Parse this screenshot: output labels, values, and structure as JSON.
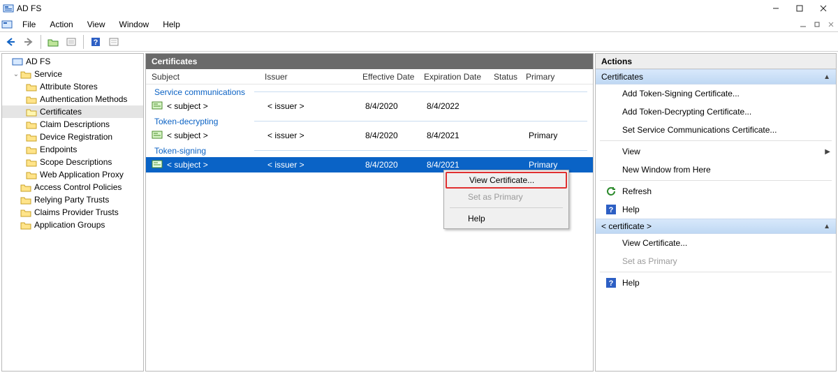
{
  "window": {
    "title": "AD FS"
  },
  "menubar": {
    "file": "File",
    "action": "Action",
    "view": "View",
    "window": "Window",
    "help": "Help"
  },
  "tree": {
    "root": "AD FS",
    "service": "Service",
    "children": [
      "Attribute Stores",
      "Authentication Methods",
      "Certificates",
      "Claim Descriptions",
      "Device Registration",
      "Endpoints",
      "Scope Descriptions",
      "Web Application Proxy"
    ],
    "selected": "Certificates",
    "top_level": [
      "Access Control Policies",
      "Relying Party Trusts",
      "Claims Provider Trusts",
      "Application Groups"
    ]
  },
  "mid": {
    "title": "Certificates",
    "columns": {
      "subject": "Subject",
      "issuer": "Issuer",
      "effective": "Effective Date",
      "expiration": "Expiration Date",
      "status": "Status",
      "primary": "Primary"
    },
    "groups": [
      {
        "name": "Service communications",
        "rows": [
          {
            "subject": "< subject >",
            "issuer": "< issuer >",
            "effective": "8/4/2020",
            "expiration": "8/4/2022",
            "status": "",
            "primary": ""
          }
        ]
      },
      {
        "name": "Token-decrypting",
        "rows": [
          {
            "subject": "< subject >",
            "issuer": "< issuer >",
            "effective": "8/4/2020",
            "expiration": "8/4/2021",
            "status": "",
            "primary": "Primary"
          }
        ]
      },
      {
        "name": "Token-signing",
        "rows": [
          {
            "subject": "< subject >",
            "issuer": "< issuer >",
            "effective": "8/4/2020",
            "expiration": "8/4/2021",
            "status": "",
            "primary": "Primary",
            "selected": true
          }
        ]
      }
    ],
    "context_menu": {
      "view_cert": "View Certificate...",
      "set_primary": "Set as Primary",
      "help": "Help"
    }
  },
  "actions": {
    "title": "Actions",
    "section1_title": "Certificates",
    "items1": [
      "Add Token-Signing Certificate...",
      "Add Token-Decrypting Certificate...",
      "Set Service Communications Certificate..."
    ],
    "view": "View",
    "new_window": "New Window from Here",
    "refresh": "Refresh",
    "help": "Help",
    "section2_title": "< certificate >",
    "view_cert": "View Certificate...",
    "set_primary": "Set as Primary"
  }
}
